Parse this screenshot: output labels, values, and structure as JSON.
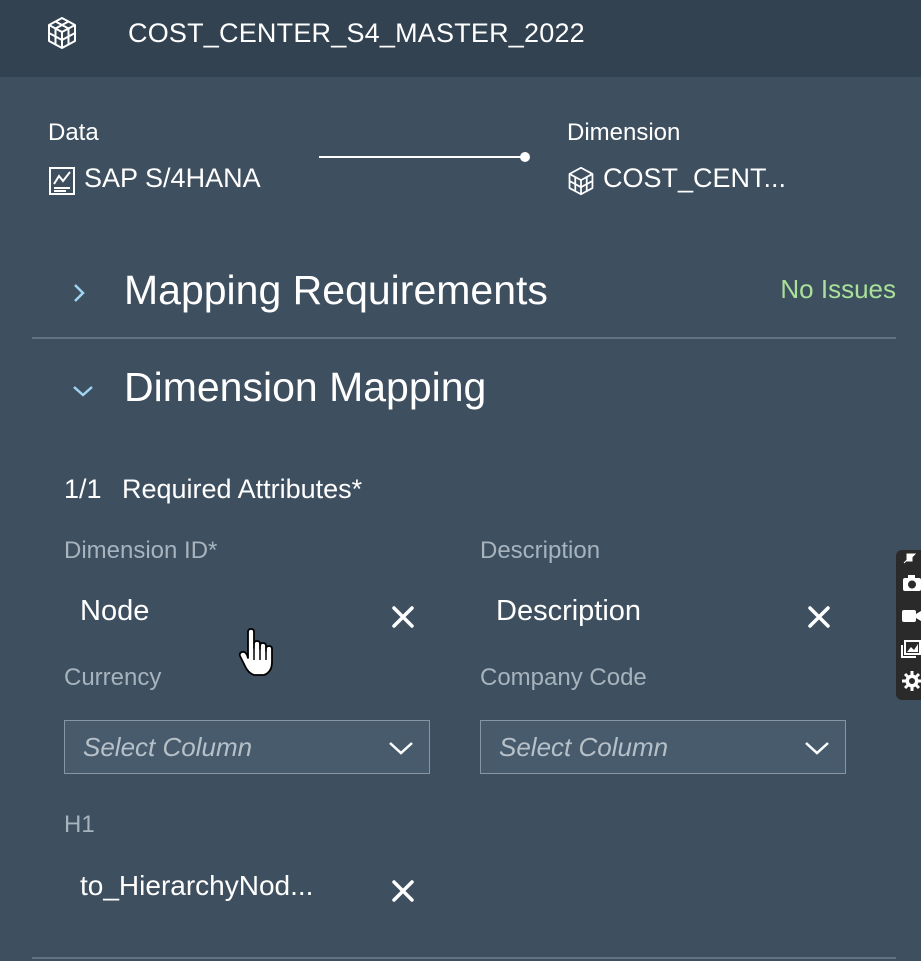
{
  "header": {
    "title": "COST_CENTER_S4_MASTER_2022",
    "icon": "cube-icon"
  },
  "flow": {
    "source": {
      "heading": "Data",
      "name": "SAP S/4HANA",
      "icon": "data-source-icon"
    },
    "target": {
      "heading": "Dimension",
      "name": "COST_CENT...",
      "icon": "cube-icon"
    }
  },
  "mapping_requirements": {
    "title": "Mapping Requirements",
    "status": "No Issues",
    "expanded": false
  },
  "dimension_mapping": {
    "title": "Dimension Mapping",
    "expanded": true,
    "required_count": "1/1",
    "required_label": "Required Attributes*",
    "fields": {
      "dimension_id": {
        "label": "Dimension ID*",
        "value": "Node"
      },
      "description": {
        "label": "Description",
        "value": "Description"
      },
      "currency": {
        "label": "Currency",
        "placeholder": "Select Column"
      },
      "company_code": {
        "label": "Company Code",
        "placeholder": "Select Column"
      },
      "h1": {
        "label": "H1",
        "value": "to_HierarchyNod..."
      }
    }
  },
  "colors": {
    "background": "#3e4f5f",
    "topbar": "#324251",
    "status_ok": "#a9e19a",
    "muted_label": "#a7b3bd"
  }
}
